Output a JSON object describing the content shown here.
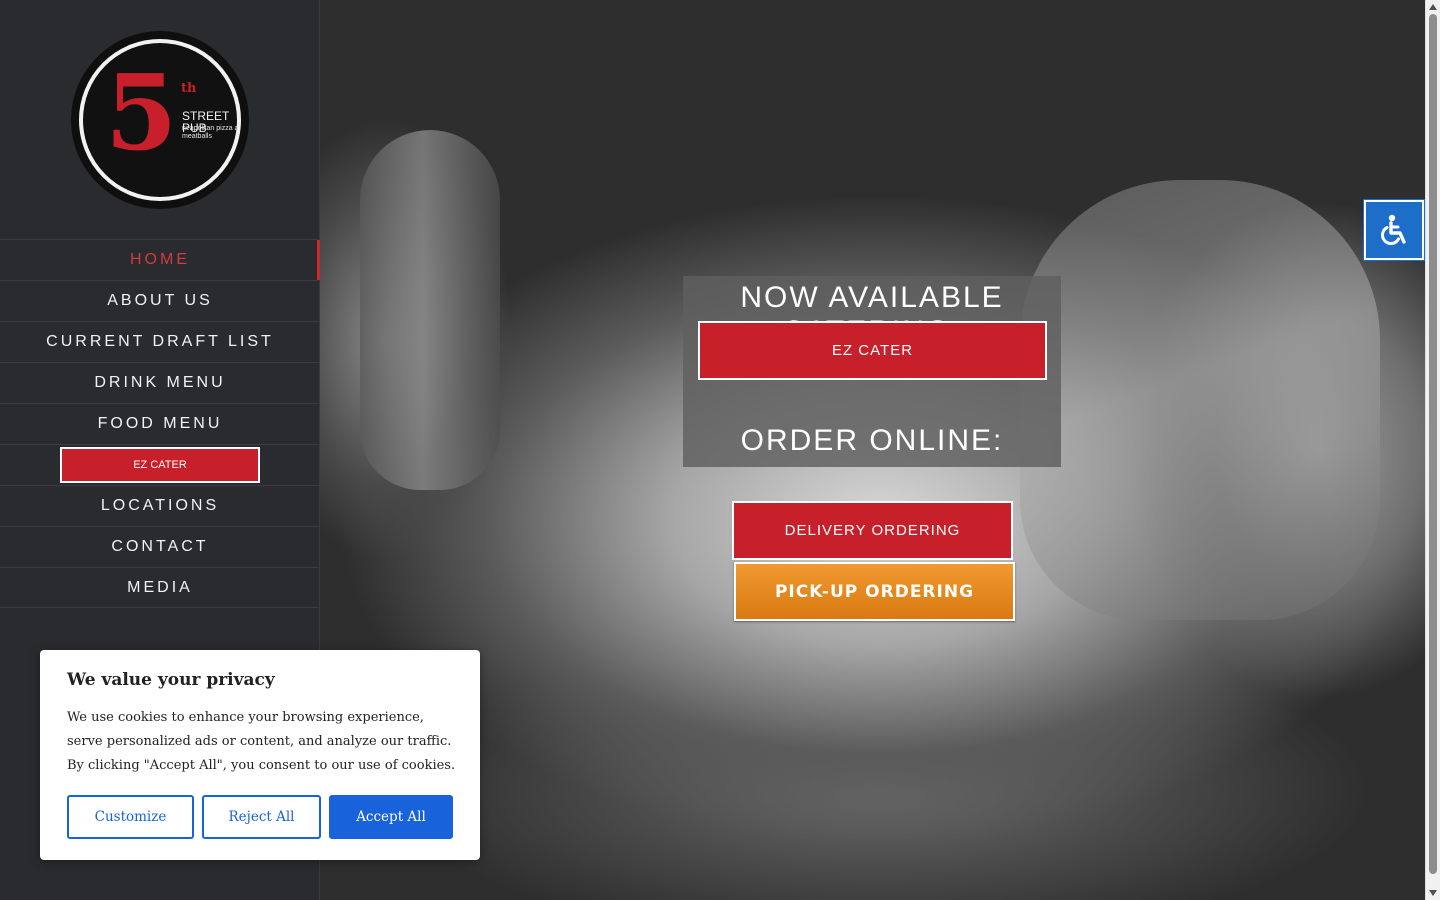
{
  "logo": {
    "numeral": "5",
    "suffix": "th",
    "name": "STREET PUB",
    "tagline": "neapolitan pizza and meatballs"
  },
  "nav": {
    "items": [
      {
        "label": "HOME",
        "active": true
      },
      {
        "label": "ABOUT US"
      },
      {
        "label": "CURRENT DRAFT LIST"
      },
      {
        "label": "DRINK MENU"
      },
      {
        "label": "FOOD MENU"
      },
      {
        "label": "EZ CATER",
        "button": true
      },
      {
        "label": "LOCATIONS"
      },
      {
        "label": "CONTACT"
      },
      {
        "label": "MEDIA"
      }
    ]
  },
  "hero": {
    "catering_title": "NOW AVAILABLE CATERING:",
    "catering_button": "EZ CATER",
    "order_title": "ORDER ONLINE:",
    "delivery_button": "DELIVERY ORDERING",
    "pickup_button": "PICK-UP ORDERING"
  },
  "accessibility": {
    "icon": "wheelchair-icon"
  },
  "cookie": {
    "title": "We value your privacy",
    "body": "We use cookies to enhance your browsing experience, serve personalized ads or content, and analyze our traffic. By clicking \"Accept All\", you consent to our use of cookies.",
    "customize": "Customize",
    "reject": "Reject All",
    "accept": "Accept All"
  },
  "colors": {
    "brand_red": "#c8202a",
    "active_nav": "#d13b3e",
    "pickup_orange": "#e58a22",
    "accent_blue": "#1863dc",
    "sidebar_bg": "#2a2b2f"
  }
}
